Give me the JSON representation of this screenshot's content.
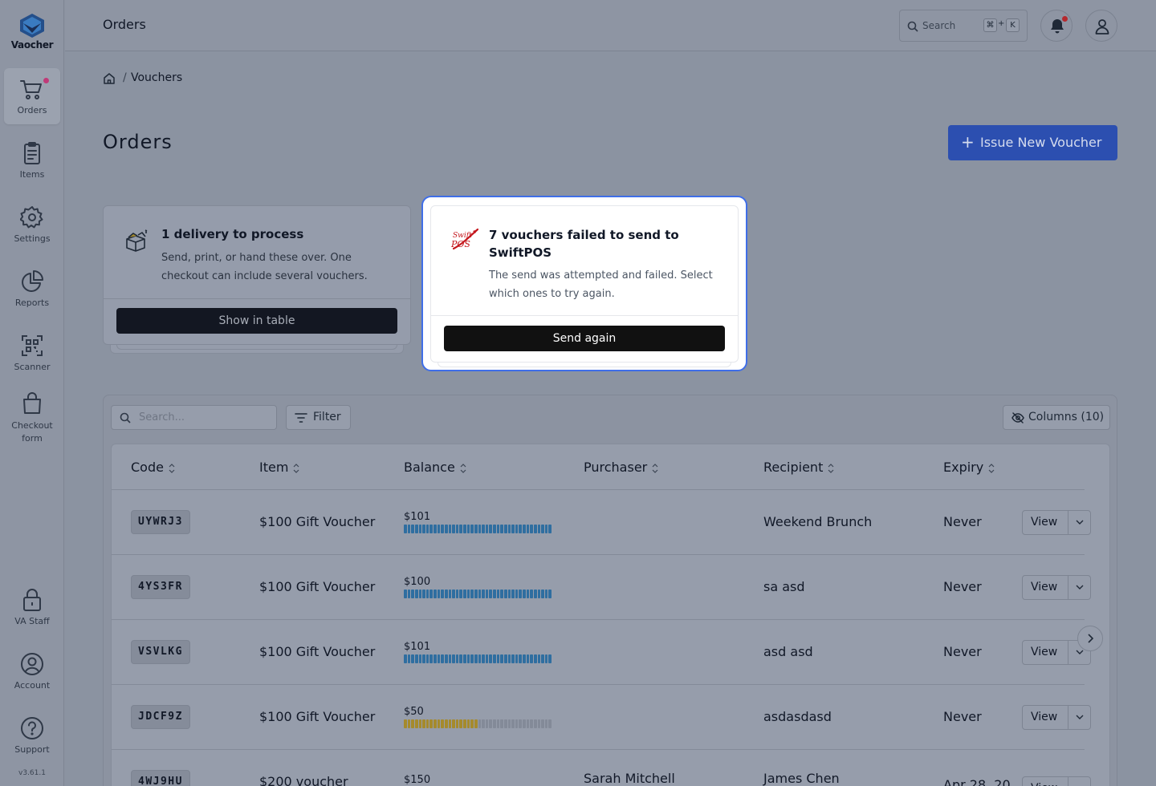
{
  "app": {
    "name": "Vaocher",
    "version": "v3.61.1"
  },
  "sidebar": {
    "items": [
      {
        "label": "Orders",
        "icon": "cart-icon",
        "active": true,
        "has_dot": true
      },
      {
        "label": "Items",
        "icon": "clipboard-icon"
      },
      {
        "label": "Settings",
        "icon": "gear-icon"
      },
      {
        "label": "Reports",
        "icon": "pie-chart-icon"
      },
      {
        "label": "Scanner",
        "icon": "qr-scan-icon"
      },
      {
        "label": "Checkout form",
        "icon": "bag-icon"
      }
    ],
    "bottom_items": [
      {
        "label": "VA Staff",
        "icon": "lock-icon"
      },
      {
        "label": "Account",
        "icon": "user-circle-icon"
      },
      {
        "label": "Support",
        "icon": "help-circle-icon"
      }
    ]
  },
  "topbar": {
    "title": "Orders",
    "search_placeholder": "Search",
    "shortcut_keys": [
      "⌘",
      "K"
    ],
    "shortcut_plus": "+"
  },
  "breadcrumb": {
    "separator": "/",
    "current": "Vouchers"
  },
  "page": {
    "title": "Orders",
    "issue_button": {
      "plus": "+",
      "label": "Issue New Voucher"
    }
  },
  "delivery_card": {
    "title": "1 delivery to process",
    "description": "Send, print, or hand these over. One checkout can include several vouchers.",
    "button": "Show in table"
  },
  "failed_card": {
    "logo_text": "SwiftPOS",
    "title": "7 vouchers failed to send to SwiftPOS",
    "description": "The send was attempted and failed. Select which ones to try again.",
    "button": "Send again"
  },
  "table": {
    "search_placeholder": "Search...",
    "filter_label": "Filter",
    "columns_label": "Columns (10)",
    "headers": [
      "Code",
      "Item",
      "Balance",
      "Purchaser",
      "Recipient",
      "Expiry"
    ],
    "view_label": "View",
    "rows": [
      {
        "code": "UYWRJ3",
        "item": "$100 Gift Voucher",
        "balance": "$101",
        "balance_fraction": 1.0,
        "bar_color": "#2f6ea0",
        "purchaser": "",
        "recipient": "Weekend Brunch",
        "expiry": "Never"
      },
      {
        "code": "4YS3FR",
        "item": "$100 Gift Voucher",
        "balance": "$100",
        "balance_fraction": 1.0,
        "bar_color": "#2f6ea0",
        "purchaser": "",
        "recipient": "sa asd",
        "expiry": "Never"
      },
      {
        "code": "VSVLKG",
        "item": "$100 Gift Voucher",
        "balance": "$101",
        "balance_fraction": 1.0,
        "bar_color": "#2f6ea0",
        "purchaser": "",
        "recipient": "asd asd",
        "expiry": "Never"
      },
      {
        "code": "JDCF9Z",
        "item": "$100 Gift Voucher",
        "balance": "$50",
        "balance_fraction": 0.5,
        "bar_color": "#a58a2c",
        "purchaser": "",
        "recipient": "asdasdasd",
        "expiry": "Never"
      },
      {
        "code": "4WJ9HU",
        "item": "$200 voucher",
        "balance": "$150",
        "balance_fraction": 0.75,
        "bar_color": "#2f6ea0",
        "purchaser": "Sarah Mitchell",
        "recipient": "James Chen",
        "expiry": "Apr 28, 20"
      }
    ]
  },
  "colors": {
    "accent": "#3f6ee8",
    "overlay": "#8b93a1",
    "notification_dot": "#b5292e",
    "orders_dot": "#c03a78"
  }
}
